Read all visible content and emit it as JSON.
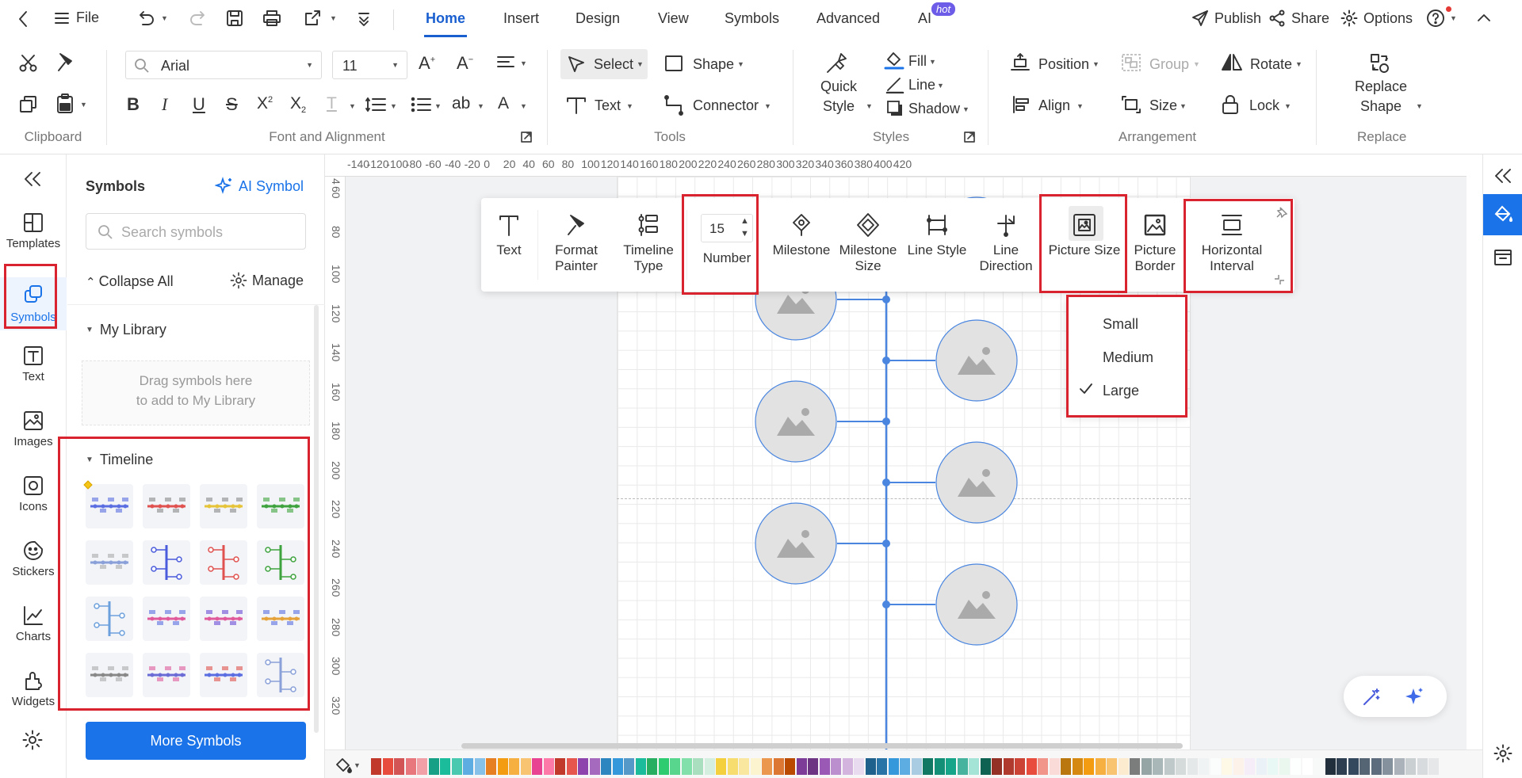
{
  "topbar": {
    "file_label": "File",
    "tabs": [
      "Home",
      "Insert",
      "Design",
      "View",
      "Symbols",
      "Advanced",
      "AI"
    ],
    "ai_badge": "hot",
    "publish": "Publish",
    "share": "Share",
    "options": "Options"
  },
  "ribbon": {
    "font_name": "Arial",
    "font_size": "11",
    "select": "Select",
    "shape": "Shape",
    "text": "Text",
    "connector": "Connector",
    "quick_style_1": "Quick",
    "quick_style_2": "Style",
    "fill": "Fill",
    "line": "Line",
    "shadow": "Shadow",
    "position": "Position",
    "group": "Group",
    "rotate": "Rotate",
    "align": "Align",
    "size": "Size",
    "lock": "Lock",
    "replace_shape_1": "Replace",
    "replace_shape_2": "Shape",
    "groups": {
      "clipboard": "Clipboard",
      "font": "Font and Alignment",
      "tools": "Tools",
      "styles": "Styles",
      "arrangement": "Arrangement",
      "replace": "Replace"
    }
  },
  "rail": {
    "items": [
      "Templates",
      "Symbols",
      "Text",
      "Images",
      "Icons",
      "Stickers",
      "Charts",
      "Widgets"
    ]
  },
  "panel": {
    "title": "Symbols",
    "ai_symbol": "AI Symbol",
    "search_placeholder": "Search symbols",
    "collapse_all": "Collapse All",
    "manage": "Manage",
    "my_library": "My Library",
    "drag_hint_1": "Drag symbols here",
    "drag_hint_2": "to add to My Library",
    "timeline": "Timeline",
    "more_symbols": "More Symbols"
  },
  "ruler": {
    "h_labels": [
      "-140",
      "-120",
      "-100",
      "-80",
      "-60",
      "-40",
      "-20",
      "0",
      "20",
      "40",
      "60",
      "80",
      "100",
      "120",
      "140",
      "160",
      "180",
      "200",
      "220",
      "240",
      "260",
      "280",
      "300",
      "320",
      "340",
      "360",
      "380",
      "400",
      "420"
    ],
    "v_labels": [
      "4",
      "60",
      "80",
      "100",
      "120",
      "140",
      "160",
      "180",
      "200",
      "220",
      "240",
      "260",
      "280",
      "300",
      "320"
    ]
  },
  "float_toolbar": {
    "text": "Text",
    "format_painter_1": "Format",
    "format_painter_2": "Painter",
    "timeline_type_1": "Timeline",
    "timeline_type_2": "Type",
    "number_value": "15",
    "number": "Number",
    "milestone": "Milestone",
    "milestone_size_1": "Milestone",
    "milestone_size_2": "Size",
    "line_style": "Line Style",
    "line_direction_1": "Line",
    "line_direction_2": "Direction",
    "picture_size": "Picture Size",
    "picture_border_1": "Picture",
    "picture_border_2": "Border",
    "horizontal_interval_1": "Horizontal",
    "horizontal_interval_2": "Interval"
  },
  "picture_size_menu": {
    "options": [
      "Small",
      "Medium",
      "Large"
    ],
    "selected": "Large"
  },
  "colors": {
    "accent": "#1a73e8",
    "highlight": "#d9232e",
    "timeline": "#4a86e0",
    "more_symbols_btn": "#1a73e8"
  }
}
